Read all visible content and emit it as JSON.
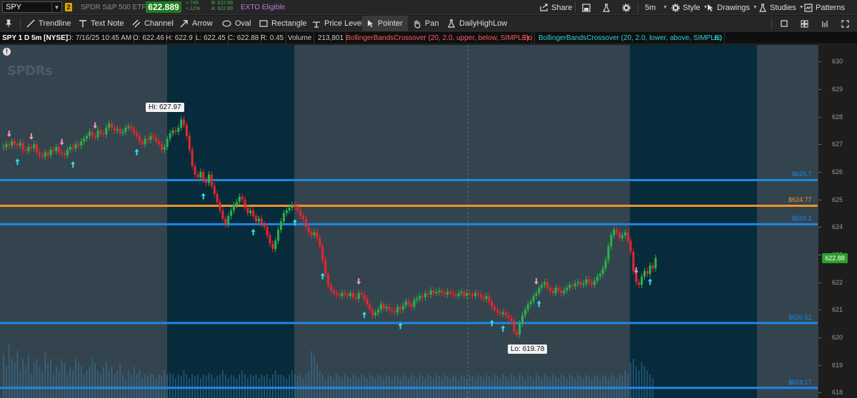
{
  "header": {
    "symbol": "SPY",
    "link_badge": "2",
    "description": "SPDR S&P 500 ETF",
    "last_price": "622.889",
    "net_change": "+.749",
    "pct_change": "+.12%",
    "bid": "B: 622.88",
    "ask": "A: 622.89",
    "exto": "EXTO Eligible",
    "share_label": "Share",
    "timeframe_label": "5m",
    "style_label": "Style",
    "drawings_label": "Drawings",
    "studies_label": "Studies",
    "patterns_label": "Patterns"
  },
  "toolbar": {
    "items": [
      {
        "label": "Trendline",
        "icon": "trendline-icon"
      },
      {
        "label": "Text Note",
        "icon": "text-note-icon"
      },
      {
        "label": "Channel",
        "icon": "channel-icon"
      },
      {
        "label": "Arrow",
        "icon": "arrow-icon"
      },
      {
        "label": "Oval",
        "icon": "oval-icon"
      },
      {
        "label": "Rectangle",
        "icon": "rectangle-icon"
      },
      {
        "label": "Price Level",
        "icon": "price-level-icon"
      },
      {
        "label": "Pointer",
        "icon": "pointer-icon"
      },
      {
        "label": "Pan",
        "icon": "pan-icon"
      },
      {
        "label": "DailyHighLow",
        "icon": "flask-icon"
      }
    ]
  },
  "info_line": {
    "title": "SPY 1 D 5m [NYSE]",
    "datetime": "D: 7/16/25 10:45 AM",
    "open": "O: 622.46",
    "high": "H: 622.9",
    "low": "L: 622.45",
    "close": "C: 622.88",
    "range": "R: 0.45",
    "volume_label": "Volume",
    "volume_value": "213,801",
    "study1": "BollingerBandsCrossover (20, 2.0, upper, below, SIMPLE)",
    "study1_value": "no",
    "study2": "BollingerBandsCrossover (20, 2.0, lower, above, SIMPLE)",
    "study2_value": "no"
  },
  "chart_data": {
    "type": "candlestick",
    "y_axis": {
      "min": 617.8,
      "max": 630.6,
      "ticks": [
        "630",
        "629",
        "628",
        "627",
        "626",
        "625",
        "624",
        "623",
        "622",
        "621",
        "620",
        "619",
        "618"
      ]
    },
    "current_price_label": "622.88",
    "high_marker": "Hi: 627.97",
    "low_marker": "Lo: 619.78",
    "price_levels": [
      {
        "value": 625.7,
        "label": "$625.7",
        "color": "#1e88e5"
      },
      {
        "value": 624.77,
        "label": "$624.77",
        "color": "#f0922b"
      },
      {
        "value": 624.1,
        "label": "$624.1",
        "color": "#1e88e5"
      },
      {
        "value": 620.52,
        "label": "$620.52",
        "color": "#1e88e5"
      },
      {
        "value": 618.17,
        "label": "$618.17",
        "color": "#1e88e5"
      }
    ],
    "closes": [
      626.9,
      627.0,
      626.95,
      627.1,
      627.0,
      626.95,
      627.05,
      626.8,
      626.75,
      626.9,
      626.85,
      627.0,
      626.7,
      626.6,
      626.55,
      626.7,
      626.6,
      626.8,
      626.75,
      626.9,
      626.7,
      626.65,
      626.6,
      626.8,
      626.9,
      626.85,
      627.0,
      626.95,
      627.1,
      627.2,
      627.3,
      627.45,
      627.3,
      627.25,
      627.5,
      627.4,
      627.35,
      627.6,
      627.75,
      627.6,
      627.5,
      627.55,
      627.4,
      627.45,
      627.6,
      627.65,
      627.55,
      627.4,
      627.3,
      627.1,
      627.0,
      627.2,
      627.15,
      627.3,
      627.25,
      627.1,
      627.0,
      626.8,
      626.9,
      627.2,
      627.4,
      627.5,
      627.45,
      627.6,
      627.9,
      627.7,
      627.3,
      626.8,
      626.2,
      625.9,
      625.8,
      626.0,
      625.7,
      625.6,
      625.9,
      625.5,
      625.2,
      624.9,
      624.6,
      624.3,
      624.1,
      624.4,
      624.6,
      624.8,
      624.9,
      625.1,
      625.0,
      624.7,
      624.5,
      624.6,
      624.4,
      624.2,
      624.3,
      624.1,
      624.0,
      623.7,
      623.4,
      623.2,
      623.5,
      623.9,
      624.2,
      624.5,
      624.6,
      624.7,
      624.8,
      624.75,
      624.6,
      624.4,
      624.3,
      624.0,
      623.8,
      623.7,
      623.8,
      623.6,
      623.3,
      622.8,
      622.3,
      621.9,
      621.7,
      621.6,
      621.55,
      621.5,
      621.6,
      621.55,
      621.5,
      621.6,
      621.45,
      621.4,
      621.6,
      621.55,
      621.4,
      621.2,
      621.0,
      620.8,
      620.9,
      621.0,
      621.2,
      621.05,
      621.1,
      621.0,
      620.95,
      620.9,
      621.1,
      621.0,
      621.15,
      621.3,
      621.2,
      621.1,
      621.35,
      621.4,
      621.5,
      621.45,
      621.6,
      621.55,
      621.7,
      621.6,
      621.65,
      621.7,
      621.6,
      621.55,
      621.65,
      621.6,
      621.55,
      621.5,
      621.6,
      621.65,
      621.5,
      621.6,
      621.55,
      621.5,
      621.6,
      621.55,
      621.45,
      621.4,
      621.5,
      621.3,
      621.1,
      621.0,
      620.9,
      620.85,
      620.9,
      620.8,
      620.7,
      620.6,
      620.2,
      620.1,
      620.5,
      620.8,
      621.0,
      621.2,
      621.3,
      621.5,
      621.6,
      621.8,
      621.9,
      622.0,
      621.8,
      621.7,
      621.6,
      621.8,
      621.7,
      621.6,
      621.7,
      621.8,
      621.9,
      621.85,
      621.95,
      622.0,
      621.9,
      621.95,
      622.1,
      622.0,
      621.9,
      622.05,
      622.2,
      622.3,
      622.5,
      622.8,
      623.3,
      623.7,
      623.9,
      623.8,
      623.6,
      623.7,
      623.8,
      623.5,
      623.1,
      622.4,
      622.0,
      621.9,
      622.2,
      622.4,
      622.3,
      622.6,
      622.5,
      622.88
    ],
    "volumes": [
      0.55,
      0.4,
      0.7,
      0.5,
      0.45,
      0.6,
      0.35,
      0.5,
      0.4,
      0.55,
      0.3,
      0.45,
      0.5,
      0.4,
      0.35,
      0.6,
      0.45,
      0.5,
      0.3,
      0.4,
      0.35,
      0.5,
      0.45,
      0.3,
      0.4,
      0.35,
      0.5,
      0.45,
      0.4,
      0.3,
      0.35,
      0.4,
      0.5,
      0.45,
      0.35,
      0.3,
      0.4,
      0.45,
      0.35,
      0.4,
      0.3,
      0.35,
      0.45,
      0.3,
      0.25,
      0.35,
      0.3,
      0.4,
      0.3,
      0.35,
      0.25,
      0.3,
      0.28,
      0.32,
      0.3,
      0.25,
      0.3,
      0.28,
      0.35,
      0.3,
      0.32,
      0.3,
      0.25,
      0.3,
      0.28,
      0.35,
      0.3,
      0.25,
      0.3,
      0.28,
      0.3,
      0.25,
      0.3,
      0.28,
      0.32,
      0.3,
      0.25,
      0.28,
      0.3,
      0.35,
      0.3,
      0.25,
      0.3,
      0.28,
      0.25,
      0.3,
      0.35,
      0.3,
      0.25,
      0.3,
      0.28,
      0.3,
      0.25,
      0.3,
      0.28,
      0.3,
      0.25,
      0.3,
      0.35,
      0.3,
      0.3,
      0.28,
      0.25,
      0.3,
      0.35,
      0.3,
      0.28,
      0.3,
      0.25,
      0.3,
      0.35,
      0.6,
      0.55,
      0.45,
      0.35,
      0.3,
      0.25,
      0.3,
      0.28,
      0.25,
      0.3,
      0.28,
      0.25,
      0.3,
      0.28,
      0.25,
      0.3,
      0.28,
      0.25,
      0.3,
      0.28,
      0.25,
      0.3,
      0.28,
      0.25,
      0.3,
      0.28,
      0.25,
      0.3,
      0.28,
      0.25,
      0.3,
      0.28,
      0.25,
      0.3,
      0.28,
      0.25,
      0.3,
      0.28,
      0.25,
      0.3,
      0.28,
      0.25,
      0.3,
      0.28,
      0.25,
      0.3,
      0.28,
      0.25,
      0.3,
      0.28,
      0.25,
      0.3,
      0.28,
      0.25,
      0.3,
      0.28,
      0.25,
      0.3,
      0.28,
      0.25,
      0.3,
      0.28,
      0.25,
      0.3,
      0.28,
      0.25,
      0.3,
      0.28,
      0.25,
      0.3,
      0.28,
      0.25,
      0.3,
      0.28,
      0.25,
      0.3,
      0.28,
      0.25,
      0.3,
      0.28,
      0.25,
      0.3,
      0.28,
      0.25,
      0.3,
      0.28,
      0.25,
      0.3,
      0.28,
      0.25,
      0.3,
      0.28,
      0.25,
      0.3,
      0.28,
      0.25,
      0.3,
      0.28,
      0.25,
      0.3,
      0.28,
      0.25,
      0.3,
      0.28,
      0.25,
      0.3,
      0.28,
      0.25,
      0.3,
      0.28,
      0.25,
      0.3,
      0.28,
      0.35,
      0.3,
      0.45,
      0.5,
      0.4,
      0.35,
      0.45,
      0.4,
      0.35,
      0.3,
      0.25
    ]
  },
  "colors": {
    "up": "#2bb34a",
    "down": "#e8262c",
    "bg_off_hours": "#33444f",
    "bg_regular": "#082b3b",
    "volume": "#3b7fa8",
    "up_arrow": "#2ee0e6",
    "down_arrow": "#f39ab5"
  },
  "icons": {
    "pin": "pin-icon",
    "info": "info-icon",
    "grid": "grid-icon",
    "square": "square-icon",
    "fullscreen": "fullscreen-icon"
  }
}
